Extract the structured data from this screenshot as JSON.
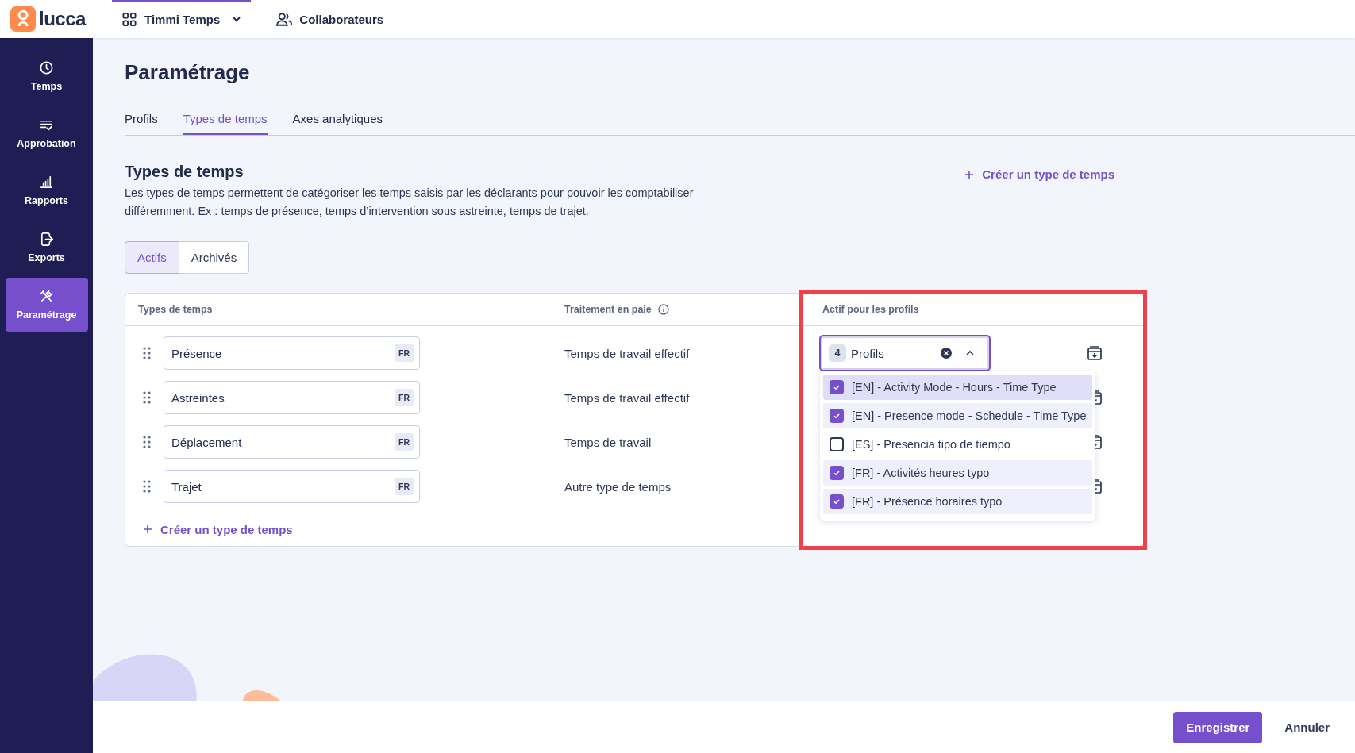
{
  "topbar": {
    "logo": "lucca",
    "nav": [
      {
        "label": "Timmi Temps",
        "kind": "apps",
        "selected": true
      },
      {
        "label": "Collaborateurs",
        "kind": "people",
        "selected": false
      }
    ]
  },
  "sidebar": {
    "items": [
      {
        "label": "Temps",
        "selected": false
      },
      {
        "label": "Approbation",
        "selected": false
      },
      {
        "label": "Rapports",
        "selected": false
      },
      {
        "label": "Exports",
        "selected": false
      },
      {
        "label": "Paramétrage",
        "selected": true
      }
    ]
  },
  "page": {
    "title": "Paramétrage",
    "tabs": [
      {
        "label": "Profils",
        "selected": false
      },
      {
        "label": "Types de temps",
        "selected": true
      },
      {
        "label": "Axes analytiques",
        "selected": false
      }
    ]
  },
  "section": {
    "title": "Types de temps",
    "description": "Les types de temps permettent de catégoriser les temps saisis par les déclarants pour pouvoir les comptabiliser différemment. Ex : temps de présence, temps d’intervention sous astreinte, temps de trajet.",
    "create_label": "Créer un type de temps"
  },
  "filter": [
    {
      "label": "Actifs",
      "selected": true
    },
    {
      "label": "Archivés",
      "selected": false
    }
  ],
  "table": {
    "columns": [
      "Types de temps",
      "Traitement en paie",
      "Actif pour les profils"
    ],
    "rows": [
      {
        "name": "Présence",
        "lang": "FR",
        "payroll": "Temps de travail effectif"
      },
      {
        "name": "Astreintes",
        "lang": "FR",
        "payroll": "Temps de travail effectif"
      },
      {
        "name": "Déplacement",
        "lang": "FR",
        "payroll": "Temps de travail"
      },
      {
        "name": "Trajet",
        "lang": "FR",
        "payroll": "Autre type de temps"
      }
    ],
    "create_label": "Créer un type de temps"
  },
  "profile_select": {
    "count": "4",
    "label": "Profils",
    "expanded": true,
    "options": [
      {
        "label": "[EN] - Activity Mode - Hours - Time Type",
        "checked": true,
        "highlighted": true
      },
      {
        "label": "[EN] - Presence mode - Schedule - Time Type",
        "checked": true,
        "highlighted": false
      },
      {
        "label": "[ES] - Presencia tipo de tiempo",
        "checked": false,
        "highlighted": false
      },
      {
        "label": "[FR] - Activités heures typo",
        "checked": true,
        "highlighted": false
      },
      {
        "label": "[FR] - Présence horaires typo",
        "checked": true,
        "highlighted": false
      }
    ]
  },
  "annotation": {
    "kind": "highlight"
  },
  "footer": {
    "save": "Enregistrer",
    "cancel": "Annuler"
  }
}
